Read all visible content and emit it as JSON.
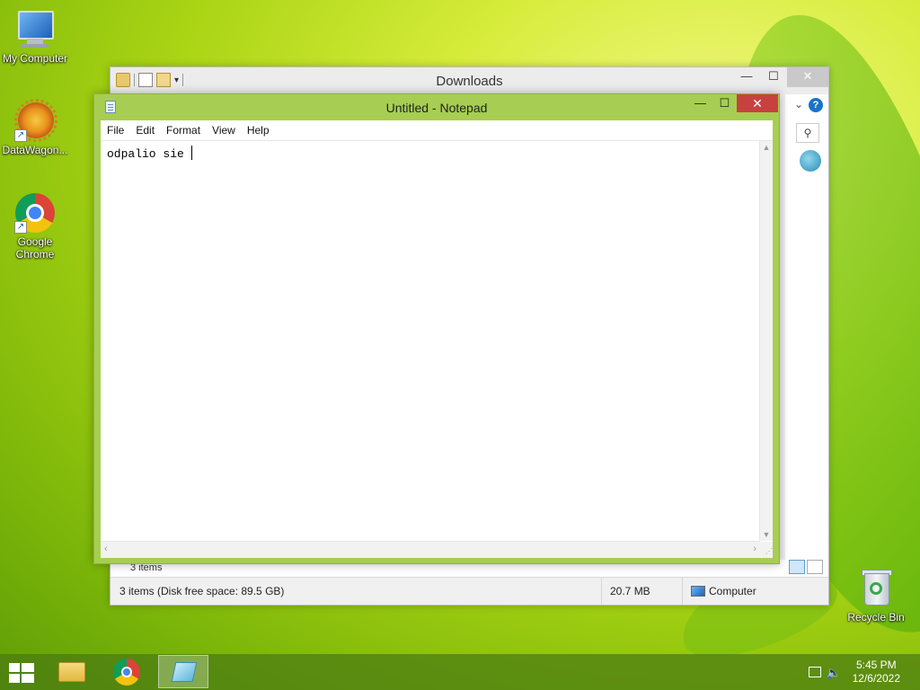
{
  "desktop": {
    "icons": [
      {
        "label": "My Computer"
      },
      {
        "label": "DataWagon..."
      },
      {
        "label": "Google Chrome"
      },
      {
        "label": "Recycle Bin"
      }
    ]
  },
  "explorer": {
    "title": "Downloads",
    "window_buttons": {
      "minimize": "—",
      "maximize": "☐",
      "close": "✕"
    },
    "item_count": "3 items",
    "status": {
      "summary": "3 items (Disk free space: 89.5 GB)",
      "size": "20.7 MB",
      "location": "Computer"
    }
  },
  "notepad": {
    "title": "Untitled - Notepad",
    "window_buttons": {
      "minimize": "—",
      "maximize": "☐",
      "close": "✕"
    },
    "menu": [
      "File",
      "Edit",
      "Format",
      "View",
      "Help"
    ],
    "content": "odpalio sie "
  },
  "taskbar": {
    "clock": {
      "time": "5:45 PM",
      "date": "12/6/2022"
    }
  }
}
